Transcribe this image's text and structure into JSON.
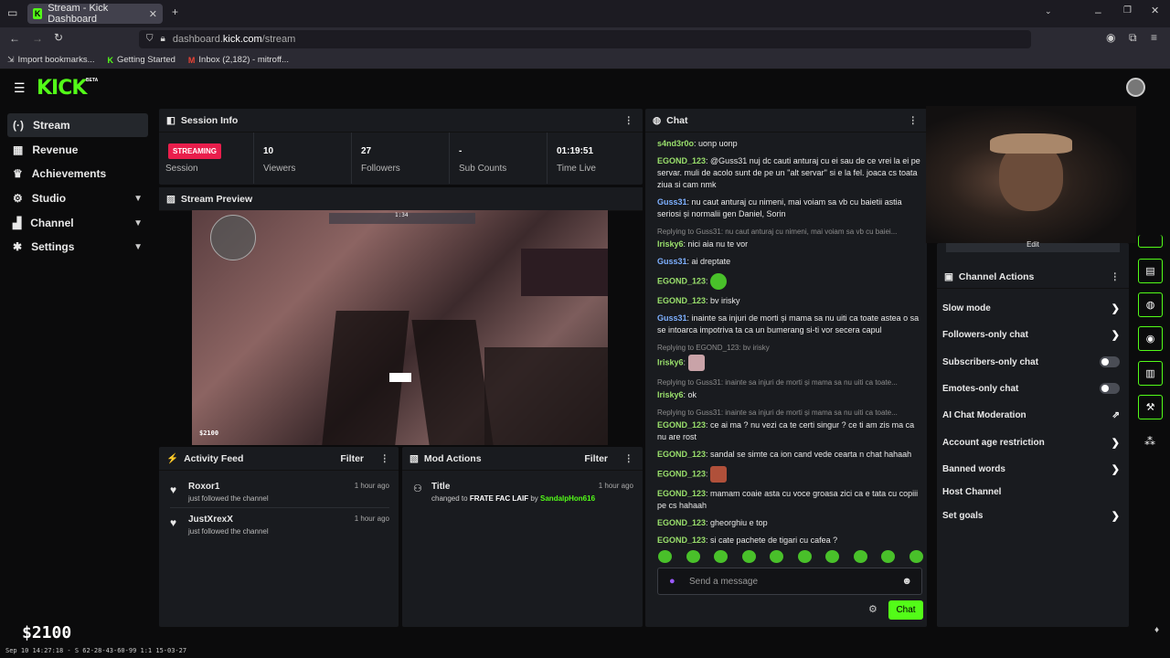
{
  "browser": {
    "tab_title": "Stream - Kick Dashboard",
    "url_prefix": "dashboard.",
    "url_domain": "kick.com",
    "url_path": "/stream",
    "bookmarks": [
      "Import bookmarks...",
      "Getting Started",
      "Inbox (2,182) - mitroff..."
    ]
  },
  "app": {
    "logo": "KICK",
    "beta": "BETA"
  },
  "sidebar": {
    "items": [
      {
        "label": "Stream",
        "icon": "broadcast-icon"
      },
      {
        "label": "Revenue",
        "icon": "revenue-icon"
      },
      {
        "label": "Achievements",
        "icon": "trophy-icon"
      },
      {
        "label": "Studio",
        "icon": "gear-icon"
      },
      {
        "label": "Channel",
        "icon": "channel-icon"
      },
      {
        "label": "Settings",
        "icon": "settings-icon"
      }
    ]
  },
  "session": {
    "title": "Session Info",
    "badge": "STREAMING",
    "stats": [
      {
        "label": "Session",
        "value": ""
      },
      {
        "label": "Viewers",
        "value": "10"
      },
      {
        "label": "Followers",
        "value": "27"
      },
      {
        "label": "Sub Counts",
        "value": "-"
      },
      {
        "label": "Time Live",
        "value": "01:19:51"
      }
    ]
  },
  "preview": {
    "title": "Stream Preview",
    "hud_money": "$2100",
    "hud_time": "1:34"
  },
  "activity": {
    "title": "Activity Feed",
    "filter": "Filter",
    "items": [
      {
        "name": "Roxor1",
        "sub": "just followed the channel",
        "time": "1 hour ago"
      },
      {
        "name": "JustXrexX",
        "sub": "just followed the channel",
        "time": "1 hour ago"
      }
    ]
  },
  "mod": {
    "title": "Mod Actions",
    "filter": "Filter",
    "item": {
      "name": "Title",
      "prefix": "changed to ",
      "value": "FRATE FAC LAIF",
      "by": " by ",
      "user": "SandalpHon616",
      "time": "1 hour ago"
    }
  },
  "chat": {
    "title": "Chat",
    "placeholder": "Send a message",
    "send": "Chat",
    "messages": [
      {
        "user": "s4nd3r0o",
        "text": "uonp uonp"
      },
      {
        "user": "EGOND_123",
        "text": "@Guss31 nuj dc cauti anturaj cu ei sau de ce vrei la ei pe servar. muli de acolo sunt de pe un ''alt servar'' si e la fel. joaca cs toata ziua si cam nmk"
      },
      {
        "user": "Guss31",
        "text": "nu caut anturaj cu nimeni, mai voiam sa vb cu baietii astia seriosi și normalii gen Daniel, Sorin"
      },
      {
        "reply": "Replying to Guss31: nu caut anturaj cu nimeni, mai voiam sa vb cu baiei...",
        "user": "Irisky6",
        "text": "nici aia nu te vor"
      },
      {
        "user": "Guss31",
        "text": "ai dreptate"
      },
      {
        "user": "EGOND_123",
        "text": ""
      },
      {
        "user": "EGOND_123",
        "text": "bv irisky"
      },
      {
        "user": "Guss31",
        "text": "inainte sa injuri de morti și mama sa nu uiti ca toate astea o sa se intoarca impotriva ta ca un bumerang si-ti vor secera capul"
      },
      {
        "reply": "Replying to EGOND_123: bv irisky",
        "user": "Irisky6",
        "text": ""
      },
      {
        "reply": "Replying to Guss31: inainte sa injuri de morti și mama sa nu uiti ca toate...",
        "user": "Irisky6",
        "text": "ok"
      },
      {
        "reply": "Replying to Guss31: inainte sa injuri de morti și mama sa nu uiti ca toate...",
        "user": "EGOND_123",
        "text": "ce ai ma ? nu vezi ca te certi singur ? ce ti am zis ma ca nu are rost"
      },
      {
        "user": "EGOND_123",
        "text": "sandal se simte ca ion cand vede cearta n chat hahaah"
      },
      {
        "user": "EGOND_123",
        "text": ""
      },
      {
        "user": "EGOND_123",
        "text": "mamam coaie asta cu voce groasa zici ca e tata cu copiii pe cs hahaah"
      },
      {
        "user": "EGOND_123",
        "text": "gheorghiu e top"
      },
      {
        "user": "EGOND_123",
        "text": "si cate pachete de tigari cu cafea ?"
      }
    ]
  },
  "channel_actions": {
    "edit": "Edit",
    "title": "Channel Actions",
    "items": [
      {
        "label": "Slow mode",
        "control": "chevron"
      },
      {
        "label": "Followers-only chat",
        "control": "chevron"
      },
      {
        "label": "Subscribers-only chat",
        "control": "toggle"
      },
      {
        "label": "Emotes-only chat",
        "control": "toggle"
      },
      {
        "label": "AI Chat Moderation",
        "control": "external"
      },
      {
        "label": "Account age restriction",
        "control": "chevron"
      },
      {
        "label": "Banned words",
        "control": "chevron"
      },
      {
        "label": "Host Channel",
        "control": "none"
      },
      {
        "label": "Set goals",
        "control": "chevron"
      }
    ]
  },
  "overlay": {
    "money": "$2100",
    "footer": "Sep 10 14:27:18 - S 62-28-43-60-99 1:1 15-03-27"
  },
  "colors": {
    "accent": "#53fc18",
    "live": "#e91e4c",
    "panel": "#191b1f"
  }
}
